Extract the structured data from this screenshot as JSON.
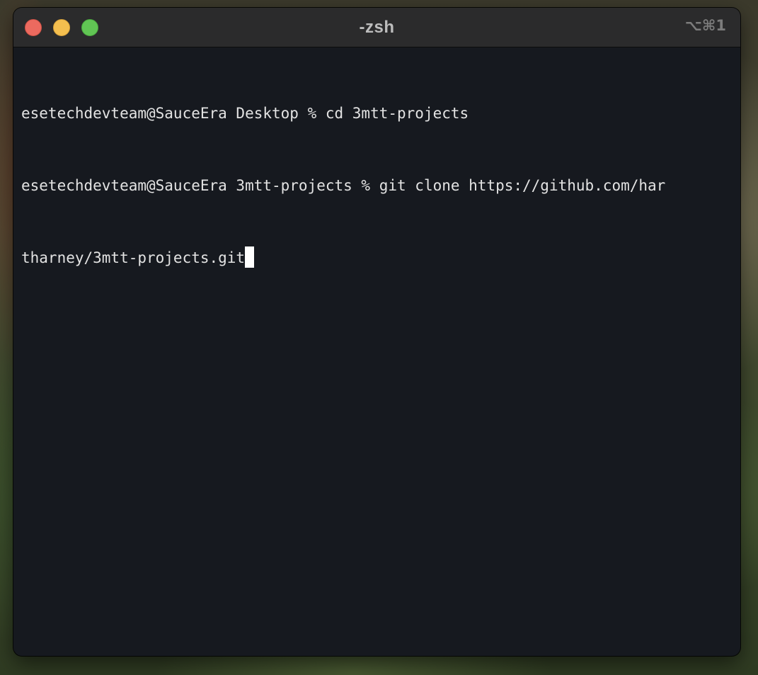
{
  "window": {
    "title": "-zsh",
    "shortcut": "⌥⌘1",
    "controls": {
      "close_icon": "close-icon",
      "minimize_icon": "minimize-icon",
      "zoom_icon": "zoom-icon",
      "close_color": "#ec6a5f",
      "minimize_color": "#f4bf4f",
      "zoom_color": "#61c554"
    }
  },
  "terminal": {
    "background": "#16191f",
    "text_color": "#e3e3e3",
    "lines": [
      "esetechdevteam@SauceEra Desktop % cd 3mtt-projects",
      "esetechdevteam@SauceEra 3mtt-projects % git clone https://github.com/har",
      "tharney/3mtt-projects.git"
    ]
  }
}
